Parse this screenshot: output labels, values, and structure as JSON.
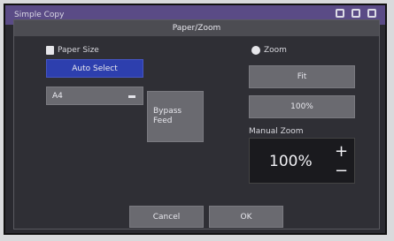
{
  "app": {
    "title": "Simple Copy"
  },
  "dialog": {
    "title": "Paper/Zoom",
    "paper_size": {
      "label": "Paper Size",
      "auto_select_label": "Auto Select",
      "selected_paper": "A4",
      "bypass_feed_label": "Bypass Feed"
    },
    "zoom": {
      "label": "Zoom",
      "fit_label": "Fit",
      "preset_label": "100%",
      "manual_label": "Manual Zoom",
      "manual_value": "100%",
      "plus_symbol": "+",
      "minus_symbol": "−"
    },
    "cancel_label": "Cancel",
    "ok_label": "OK"
  },
  "colors": {
    "accent": "#2d3fae",
    "topbar": "#5a4b86",
    "panel": "#2f2f35"
  }
}
